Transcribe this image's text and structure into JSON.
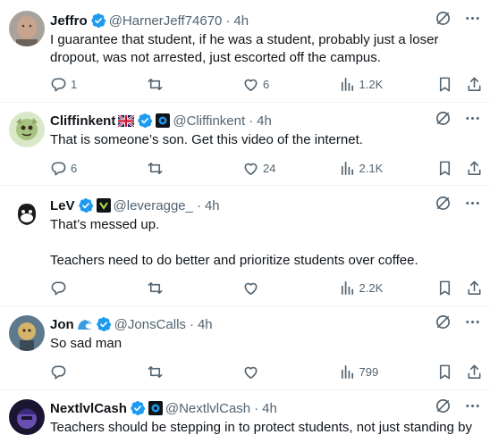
{
  "tweets": [
    {
      "name": "Jeffro",
      "handle": "@HarnerJeff74670",
      "time": "4h",
      "text": [
        "I guarantee that student, if he was a student, probably just a loser dropout, was not arrested, just escorted off the campus."
      ],
      "replies": "1",
      "retweets": "",
      "likes": "6",
      "views": "1.2K"
    },
    {
      "name": "Cliffinkent",
      "handle": "@Cliffinkent",
      "time": "4h",
      "text": [
        "That is someone’s son. Get this video of the internet."
      ],
      "replies": "6",
      "retweets": "",
      "likes": "24",
      "views": "2.1K"
    },
    {
      "name": "LeV",
      "handle": "@leveragge_",
      "time": "4h",
      "text": [
        "That’s messed up.",
        "Teachers need to do better and prioritize students over coffee."
      ],
      "replies": "",
      "retweets": "",
      "likes": "",
      "views": "2.2K"
    },
    {
      "name": "Jon",
      "handle": "@JonsCalls",
      "time": "4h",
      "text": [
        "So sad man"
      ],
      "replies": "",
      "retweets": "",
      "likes": "",
      "views": "799"
    },
    {
      "name": "NextlvlCash",
      "handle": "@NextlvlCash",
      "time": "4h",
      "text": [
        "Teachers should be stepping in to protect students, not just standing by"
      ],
      "replies": "",
      "retweets": "",
      "likes": "",
      "views": ""
    }
  ],
  "colors": {
    "verified": "#1d9bf0",
    "text": "#0f1419",
    "muted": "#536471",
    "divider": "#eff3f4"
  }
}
